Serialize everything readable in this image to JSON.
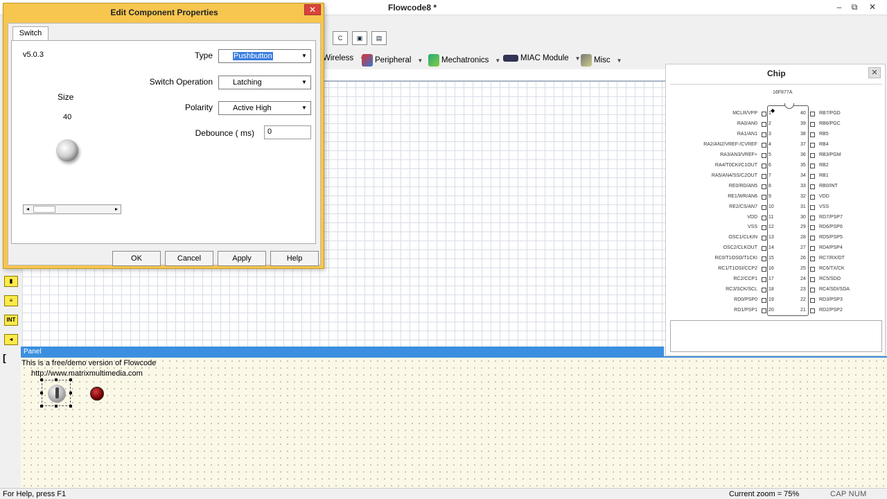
{
  "window": {
    "title": "Flowcode8 *",
    "minimize": "‒",
    "maximize": "⧉",
    "close": "✕"
  },
  "toolbar_icons": [
    "C",
    "▣",
    "▤"
  ],
  "component_menu": [
    {
      "label": "Wireless",
      "icon": "wireless-icon"
    },
    {
      "label": "Peripheral",
      "icon": "peripheral-icon"
    },
    {
      "label": "Mechatronics",
      "icon": "mechatronics-icon"
    },
    {
      "label": "MIAC Module",
      "icon": "miac-module-icon"
    },
    {
      "label": "Misc",
      "icon": "misc-icon"
    }
  ],
  "left_tools": [
    "▮",
    "≡",
    "INT",
    "◂",
    "[ "
  ],
  "dialog": {
    "title": "Edit Component Properties",
    "close": "✕",
    "tab": "Switch",
    "version": "v5.0.3",
    "size_label": "Size",
    "size_value": "40",
    "properties": {
      "type_label": "Type",
      "type_value": "Pushbutton",
      "operation_label": "Switch Operation",
      "operation_value": "Latching",
      "polarity_label": "Polarity",
      "polarity_value": "Active High",
      "debounce_label": "Debounce  ( ms)",
      "debounce_value": "0"
    },
    "buttons": {
      "ok": "OK",
      "cancel": "Cancel",
      "apply": "Apply",
      "help": "Help"
    }
  },
  "chip_panel": {
    "title": "Chip",
    "close": "✕",
    "chip_name": "16F877A",
    "left_pins": [
      {
        "num": "1",
        "label": "MCLR/VPP"
      },
      {
        "num": "2",
        "label": "RA0/AN0"
      },
      {
        "num": "3",
        "label": "RA1/AN1"
      },
      {
        "num": "4",
        "label": "RA2/AN2/VREF-/CVREF"
      },
      {
        "num": "5",
        "label": "RA3/AN3/VREF+"
      },
      {
        "num": "6",
        "label": "RA4/T0CKI/C1OUT"
      },
      {
        "num": "7",
        "label": "RA5/AN4/SS/C2OUT"
      },
      {
        "num": "8",
        "label": "RE0/RD/AN5"
      },
      {
        "num": "9",
        "label": "RE1/WR/AN6"
      },
      {
        "num": "10",
        "label": "RE2/CS/AN7"
      },
      {
        "num": "11",
        "label": "VDD"
      },
      {
        "num": "12",
        "label": "VSS"
      },
      {
        "num": "13",
        "label": "OSC1/CLKIN"
      },
      {
        "num": "14",
        "label": "OSC2/CLKOUT"
      },
      {
        "num": "15",
        "label": "RC0/T1OSO/T1CKI"
      },
      {
        "num": "16",
        "label": "RC1/T1OSI/CCP2"
      },
      {
        "num": "17",
        "label": "RC2/CCP1"
      },
      {
        "num": "18",
        "label": "RC3/SCK/SCL"
      },
      {
        "num": "19",
        "label": "RD0/PSP0"
      },
      {
        "num": "20",
        "label": "RD1/PSP1"
      }
    ],
    "right_pins": [
      {
        "num": "40",
        "label": "RB7/PGD"
      },
      {
        "num": "39",
        "label": "RB6/PGC"
      },
      {
        "num": "38",
        "label": "RB5"
      },
      {
        "num": "37",
        "label": "RB4"
      },
      {
        "num": "36",
        "label": "RB3/PGM"
      },
      {
        "num": "35",
        "label": "RB2"
      },
      {
        "num": "34",
        "label": "RB1"
      },
      {
        "num": "33",
        "label": "RB0/INT"
      },
      {
        "num": "32",
        "label": "VDD"
      },
      {
        "num": "31",
        "label": "VSS"
      },
      {
        "num": "30",
        "label": "RD7/PSP7"
      },
      {
        "num": "29",
        "label": "RD6/PSP6"
      },
      {
        "num": "28",
        "label": "RD5/PSP5"
      },
      {
        "num": "27",
        "label": "RD4/PSP4"
      },
      {
        "num": "26",
        "label": "RC7/RX/DT"
      },
      {
        "num": "25",
        "label": "RC6/TX/CK"
      },
      {
        "num": "24",
        "label": "RC5/SDO"
      },
      {
        "num": "23",
        "label": "RC4/SDI/SDA"
      },
      {
        "num": "22",
        "label": "RD3/PSP3"
      },
      {
        "num": "21",
        "label": "RD2/PSP2"
      }
    ]
  },
  "panel": {
    "title": "Panel",
    "demo_line1": "This is a free/demo version of Flowcode",
    "demo_line2": "http://www.matrixmultimedia.com"
  },
  "statusbar": {
    "help": "For Help, press F1",
    "zoom": "Current zoom = 75%",
    "keys": "CAP  NUM  SCRL"
  }
}
